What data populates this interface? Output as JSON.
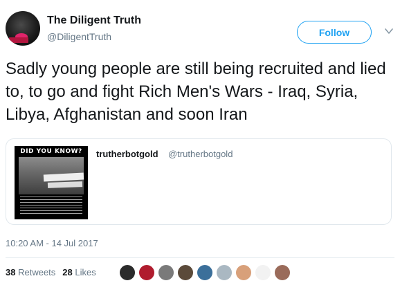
{
  "tweet": {
    "author_name": "The Diligent Truth",
    "author_handle": "@DiligentTruth",
    "follow_label": "Follow",
    "text": "Sadly young people are still being recruited and lied to, to go and fight Rich Men's Wars - Iraq, Syria, Libya, Afghanistan and soon Iran",
    "timestamp": "10:20 AM - 14 Jul 2017"
  },
  "quote": {
    "name": "trutherbotgold",
    "handle": "@trutherbotgold",
    "image_title": "DID YOU KNOW?"
  },
  "stats": {
    "retweets_count": "38",
    "retweets_label": "Retweets",
    "likes_count": "28",
    "likes_label": "Likes"
  },
  "likers": [
    {
      "name": "liker-1",
      "color": "#2b2b2b"
    },
    {
      "name": "liker-2",
      "color": "#b01c2e"
    },
    {
      "name": "liker-3",
      "color": "#7a7a7a"
    },
    {
      "name": "liker-4",
      "color": "#5b4a3a"
    },
    {
      "name": "liker-5",
      "color": "#3b6f9a"
    },
    {
      "name": "liker-6",
      "color": "#aab8c2"
    },
    {
      "name": "liker-7",
      "color": "#d8a07a"
    },
    {
      "name": "liker-8",
      "color": "#f2f2f2"
    },
    {
      "name": "liker-9",
      "color": "#9a6b5a"
    }
  ],
  "colors": {
    "accent": "#1da1f2",
    "secondary_text": "#657786",
    "primary_text": "#14171a"
  }
}
